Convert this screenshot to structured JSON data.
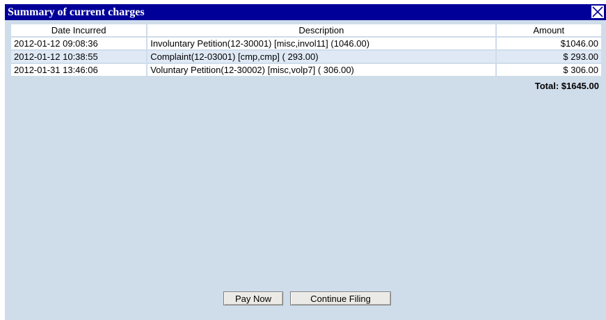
{
  "dialog": {
    "title": "Summary of current charges",
    "close_icon": "close-x-icon"
  },
  "table": {
    "headers": [
      "Date Incurred",
      "Description",
      "Amount"
    ],
    "rows": [
      {
        "date": "2012-01-12 09:08:36",
        "description": "Involuntary Petition(12-30001) [misc,invol11] (1046.00)",
        "amount": "$1046.00"
      },
      {
        "date": "2012-01-12 10:38:55",
        "description": "Complaint(12-03001) [cmp,cmp] ( 293.00)",
        "amount": "$ 293.00"
      },
      {
        "date": "2012-01-31 13:46:06",
        "description": "Voluntary Petition(12-30002) [misc,volp7] ( 306.00)",
        "amount": "$ 306.00"
      }
    ],
    "total": "Total: $1645.00"
  },
  "buttons": {
    "pay_now": "Pay Now",
    "continue_filing": "Continue Filing"
  },
  "colors": {
    "titlebar": "#000099",
    "dialog_bg": "#cfdcea",
    "alt_row": "#dfe9f5"
  }
}
